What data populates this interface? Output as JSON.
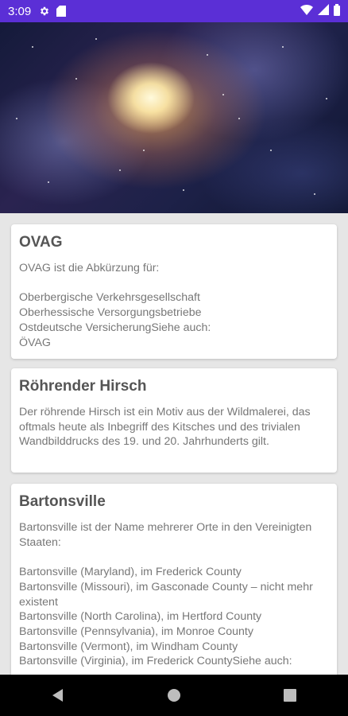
{
  "status_bar": {
    "time": "3:09",
    "icons": [
      "settings-icon",
      "sd-card-icon",
      "wifi-icon",
      "signal-icon",
      "battery-icon"
    ]
  },
  "hero": {
    "description_icon": "galaxy-image"
  },
  "cards": [
    {
      "title": "OVAG",
      "body": "OVAG ist die Abkürzung für:\n\nOberbergische Verkehrsgesellschaft\nOberhessische Versorgungsbetriebe\nOstdeutsche VersicherungSiehe auch:\nÖVAG"
    },
    {
      "title": "Röhrender Hirsch",
      "body": "Der röhrende Hirsch ist ein Motiv aus der Wildmalerei, das oftmals heute als Inbegriff des Kitsches und des trivialen Wandbilddrucks des 19. und 20. Jahrhunderts gilt."
    },
    {
      "title": "Bartonsville",
      "body": "Bartonsville ist der Name mehrerer Orte in den Vereinigten Staaten:\n\nBartonsville (Maryland), im Frederick County\nBartonsville (Missouri), im Gasconade County – nicht mehr existent\nBartonsville (North Carolina), im Hertford County\nBartonsville (Pennsylvania), im Monroe County\nBartonsville (Vermont), im Windham County\nBartonsville (Virginia), im Frederick CountySiehe auch:"
    }
  ],
  "nav_bar": {
    "buttons": [
      "back-icon",
      "home-icon",
      "recents-icon"
    ]
  },
  "colors": {
    "status_bar": "#5b2fd6",
    "background": "#e6e6e6",
    "card": "#ffffff",
    "nav_bar": "#000000"
  }
}
